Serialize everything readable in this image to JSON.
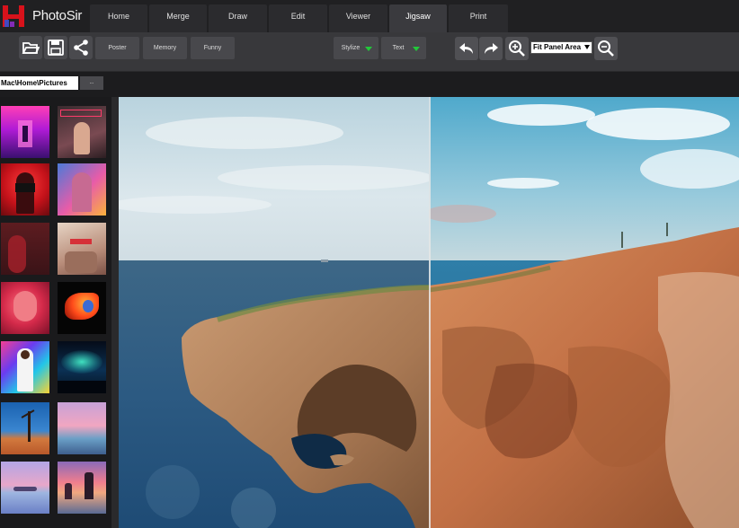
{
  "app": {
    "name": "PhotoSir",
    "brand_color": "#d8121b",
    "accent_color": "#22c83a"
  },
  "tabs": [
    {
      "label": "Home"
    },
    {
      "label": "Merge"
    },
    {
      "label": "Draw"
    },
    {
      "label": "Edit"
    },
    {
      "label": "Viewer"
    },
    {
      "label": "Jigsaw",
      "active": true
    },
    {
      "label": "Print"
    }
  ],
  "toolbar": {
    "icons": [
      "open-folder-icon",
      "save-icon",
      "share-icon",
      "undo-icon",
      "redo-icon",
      "zoom-in-icon",
      "zoom-out-icon"
    ],
    "preset_buttons": [
      {
        "label": "Poster"
      },
      {
        "label": "Memory"
      },
      {
        "label": "Funny"
      }
    ],
    "stylize_label": "Stylize",
    "text_label": "Text",
    "zoom_selected": "Fit Panel Area"
  },
  "path": {
    "value": "Mac\\Home\\Pictures",
    "browse_label": "..."
  },
  "thumbnails": [
    "pink-corridor",
    "neon-portrait",
    "red-camera-girl",
    "colorful-portrait",
    "red-silhouette",
    "sunglasses-portrait",
    "pink-face-portrait",
    "betta-fish",
    "graffiti-man",
    "aurora-night",
    "desert-tree",
    "pink-sea",
    "pink-lake",
    "sunset-rocks"
  ],
  "canvas": {
    "image": "coastal-cliff-before-after",
    "divider": "before-after-split"
  }
}
